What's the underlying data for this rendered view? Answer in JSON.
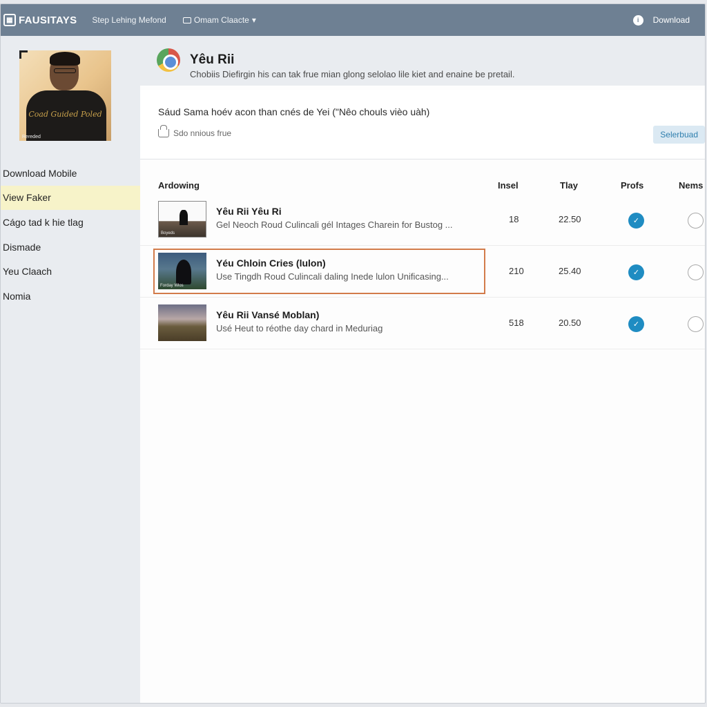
{
  "topbar": {
    "brand": "FAUSITAYS",
    "nav_link": "Step Lehing Mefond",
    "dropdown": "Omam Claacte",
    "download": "Download"
  },
  "sidebar": {
    "avatar_shirt_text": "Coad Guided Poled",
    "avatar_caption": "Rereded",
    "items": [
      {
        "label": "Download Mobile"
      },
      {
        "label": "View Faker"
      },
      {
        "label": "Cágo tad k hie tlag"
      },
      {
        "label": "Dismade"
      },
      {
        "label": "Yeu Claach"
      },
      {
        "label": "Nomia"
      }
    ]
  },
  "header": {
    "title": "Yêu Rii",
    "subtitle": "Chobiis Diefirgin his can tak frue mian glong selolao lile kiet and enaine be pretail."
  },
  "panel": {
    "text": "Sáud Sama hoév acon than cnés de Yei (\"Nêo chouls vièo uàh)",
    "meta": "Sdo nnious frue",
    "select_label": "Selerbuad"
  },
  "table": {
    "columns": [
      "Ardowing",
      "Insel",
      "Tlay",
      "Profs",
      "Nems"
    ],
    "rows": [
      {
        "title": "Yêu Rii Yêu Ri",
        "desc": "Gel Neoch Roud Culincali gél Intages Charein for Bustog ...",
        "insel": "18",
        "tlay": "22.50",
        "thumb_caption": "Boyeds"
      },
      {
        "title": "Yéu Chloin Cries (lulon)",
        "desc": "Use Tingdh Roud Culincali daling Inede lulon Unificasing...",
        "insel": "210",
        "tlay": "25.40",
        "thumb_caption": "Forday Wlos"
      },
      {
        "title": "Yêu Rii Vansé Moblan)",
        "desc": "Usé Heut to réothe day chard in Meduriag",
        "insel": "518",
        "tlay": "20.50",
        "thumb_caption": ""
      }
    ]
  },
  "colors": {
    "topbar": "#6e8093",
    "active_nav": "#f7f3c9",
    "check": "#1f8cc2",
    "highlight": "#d27b4a"
  }
}
